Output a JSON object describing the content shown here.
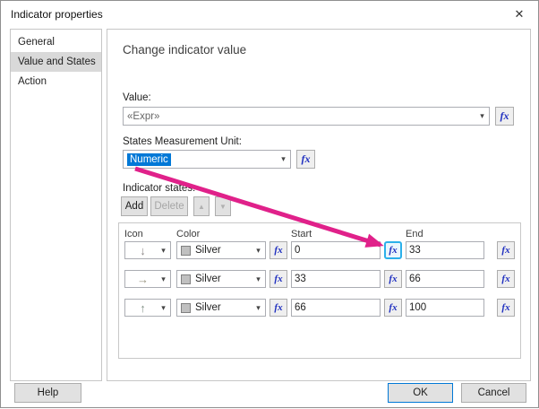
{
  "dialog": {
    "title": "Indicator properties"
  },
  "icons": {
    "close": "✕",
    "caret": "▾",
    "move_up": "▲",
    "move_down": "▼",
    "fx": "fx"
  },
  "sidebar": {
    "items": [
      {
        "label": "General",
        "selected": false
      },
      {
        "label": "Value and States",
        "selected": true
      },
      {
        "label": "Action",
        "selected": false
      }
    ]
  },
  "main": {
    "heading": "Change indicator value",
    "value_field": {
      "label": "Value:",
      "value": "«Expr»"
    },
    "unit_field": {
      "label": "States Measurement Unit:",
      "value": "Numeric"
    },
    "states": {
      "label": "Indicator states:",
      "toolbar": {
        "add": "Add",
        "delete": "Delete"
      },
      "table": {
        "headers": {
          "icon": "Icon",
          "color": "Color",
          "start": "Start",
          "end": "End"
        },
        "rows": [
          {
            "icon": "down-arrow",
            "glyph": "↓",
            "color": "Silver",
            "start": "0",
            "end": "33"
          },
          {
            "icon": "right-arrow",
            "glyph": "→",
            "color": "Silver",
            "start": "33",
            "end": "66"
          },
          {
            "icon": "up-arrow",
            "glyph": "↑",
            "color": "Silver",
            "start": "66",
            "end": "100"
          }
        ]
      }
    }
  },
  "footer": {
    "help": "Help",
    "ok": "OK",
    "cancel": "Cancel"
  },
  "colors": {
    "selection": "#0078d7",
    "annotation_arrow": "#e0218a",
    "silver_swatch": "#c0c0c0",
    "fx_highlight": "#2bb0ea"
  }
}
